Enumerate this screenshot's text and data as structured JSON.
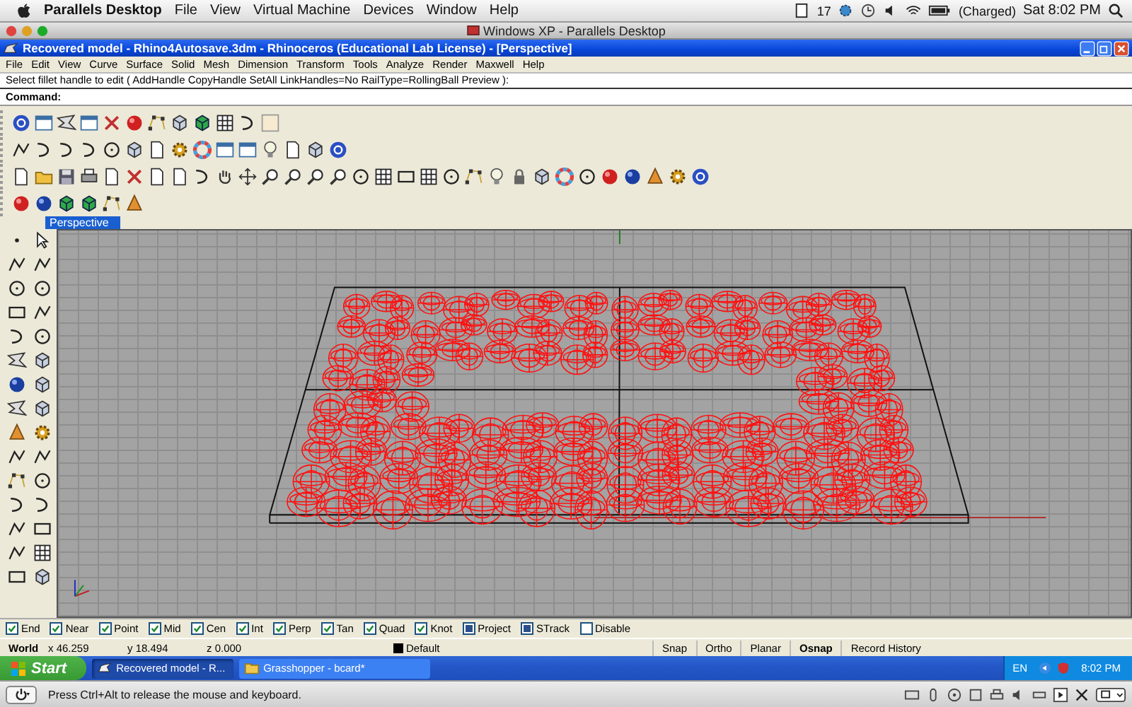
{
  "mac_menubar": {
    "app": "Parallels Desktop",
    "menus": [
      "File",
      "View",
      "Virtual Machine",
      "Devices",
      "Window",
      "Help"
    ],
    "status": {
      "badge": "17",
      "battery": "(Charged)",
      "clock": "Sat 8:02 PM"
    }
  },
  "parallels_window": {
    "title": "Windows XP - Parallels Desktop"
  },
  "rhino": {
    "title": "Recovered model - Rhino4Autosave.3dm - Rhinoceros (Educational Lab License) - [Perspective]",
    "menus": [
      "File",
      "Edit",
      "View",
      "Curve",
      "Surface",
      "Solid",
      "Mesh",
      "Dimension",
      "Transform",
      "Tools",
      "Analyze",
      "Render",
      "Maxwell",
      "Help"
    ],
    "prompt": "Select fillet handle to edit ( AddHandle  CopyHandle  SetAll  LinkHandles=No  RailType=RollingBall  Preview ):",
    "command_label": "Command:",
    "viewport_tab": "Perspective",
    "osnaps": [
      {
        "label": "End",
        "checked": true,
        "kind": "snap"
      },
      {
        "label": "Near",
        "checked": true,
        "kind": "snap"
      },
      {
        "label": "Point",
        "checked": true,
        "kind": "snap"
      },
      {
        "label": "Mid",
        "checked": true,
        "kind": "snap"
      },
      {
        "label": "Cen",
        "checked": true,
        "kind": "snap"
      },
      {
        "label": "Int",
        "checked": true,
        "kind": "snap"
      },
      {
        "label": "Perp",
        "checked": true,
        "kind": "snap"
      },
      {
        "label": "Tan",
        "checked": true,
        "kind": "snap"
      },
      {
        "label": "Quad",
        "checked": true,
        "kind": "snap"
      },
      {
        "label": "Knot",
        "checked": true,
        "kind": "snap"
      },
      {
        "label": "Project",
        "checked": true,
        "kind": "mode"
      },
      {
        "label": "STrack",
        "checked": true,
        "kind": "mode"
      },
      {
        "label": "Disable",
        "checked": false,
        "kind": "mode"
      }
    ],
    "status_bar": {
      "cplane": "World",
      "x": "x 46.259",
      "y": "y 18.494",
      "z": "z 0.000",
      "layer": {
        "name": "Default",
        "color": "#000000"
      },
      "toggles": [
        {
          "label": "Snap",
          "on": false
        },
        {
          "label": "Ortho",
          "on": false
        },
        {
          "label": "Planar",
          "on": false
        },
        {
          "label": "Osnap",
          "on": true
        },
        {
          "label": "Record History",
          "on": false
        }
      ]
    }
  },
  "taskbar": {
    "start": "Start",
    "tasks": [
      {
        "label": "Recovered model - R...",
        "selected": true,
        "kind": "app"
      },
      {
        "label": "Grasshopper - bcard*",
        "selected": false,
        "kind": "folder"
      }
    ],
    "language": "EN",
    "clock": "8:02 PM"
  },
  "parallels_bar": {
    "message": "Press Ctrl+Alt to release the mouse and keyboard."
  }
}
